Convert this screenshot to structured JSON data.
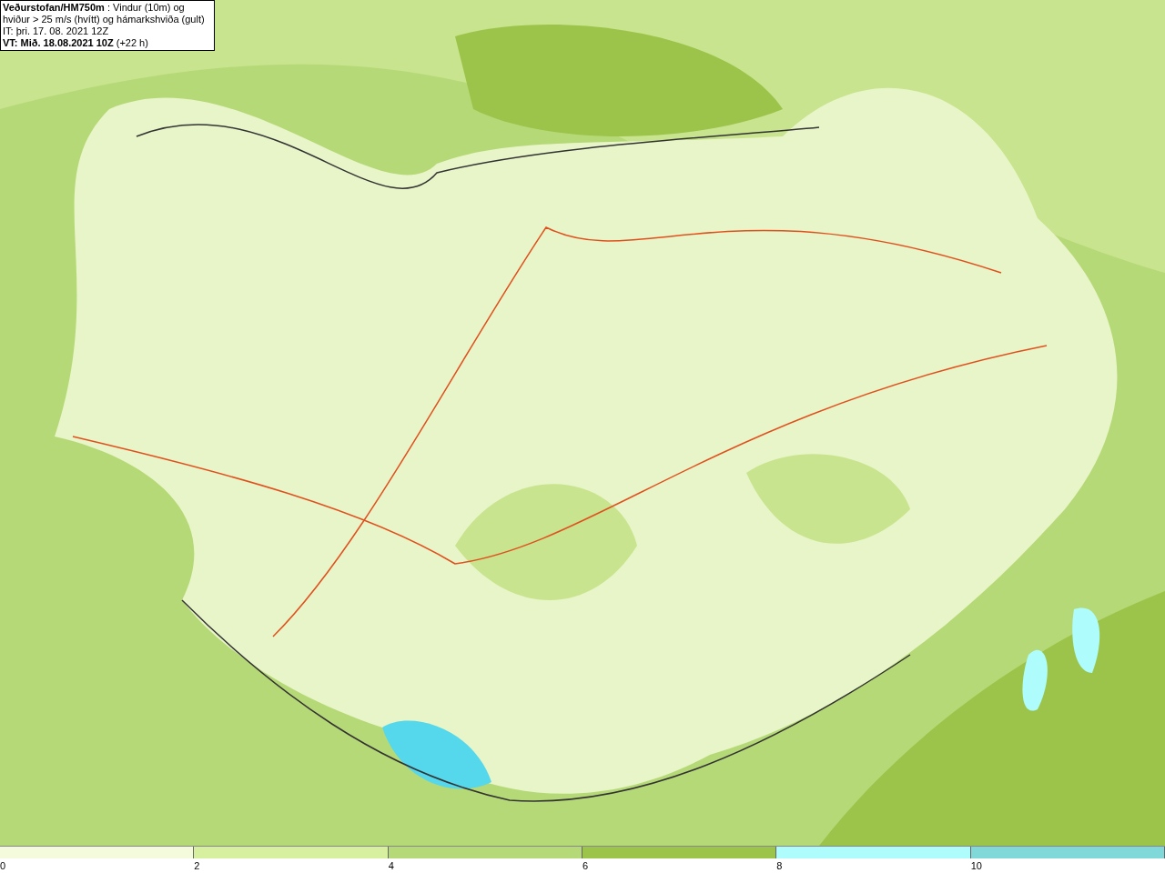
{
  "title_box": {
    "heading": "**Veðurstofan/HM750m** : Vindur (10m) og hviður > 25 m/s (hvítt) og hámarkshviða (gult)",
    "issued": "IT: þri. 17. 08. 2021 12Z",
    "valid": "**VT: Mið. 18.08.2021 10Z** (+22 h)"
  },
  "legend": {
    "bins": [
      {
        "color": "#f4fadc"
      },
      {
        "color": "#d6f0a0"
      },
      {
        "color": "#b6d977"
      },
      {
        "color": "#9cc44a"
      },
      {
        "color": "#aefcfc"
      },
      {
        "color": "#80d8d8"
      }
    ],
    "labels": [
      "0",
      "2",
      "4",
      "6",
      "8",
      "10"
    ]
  }
}
